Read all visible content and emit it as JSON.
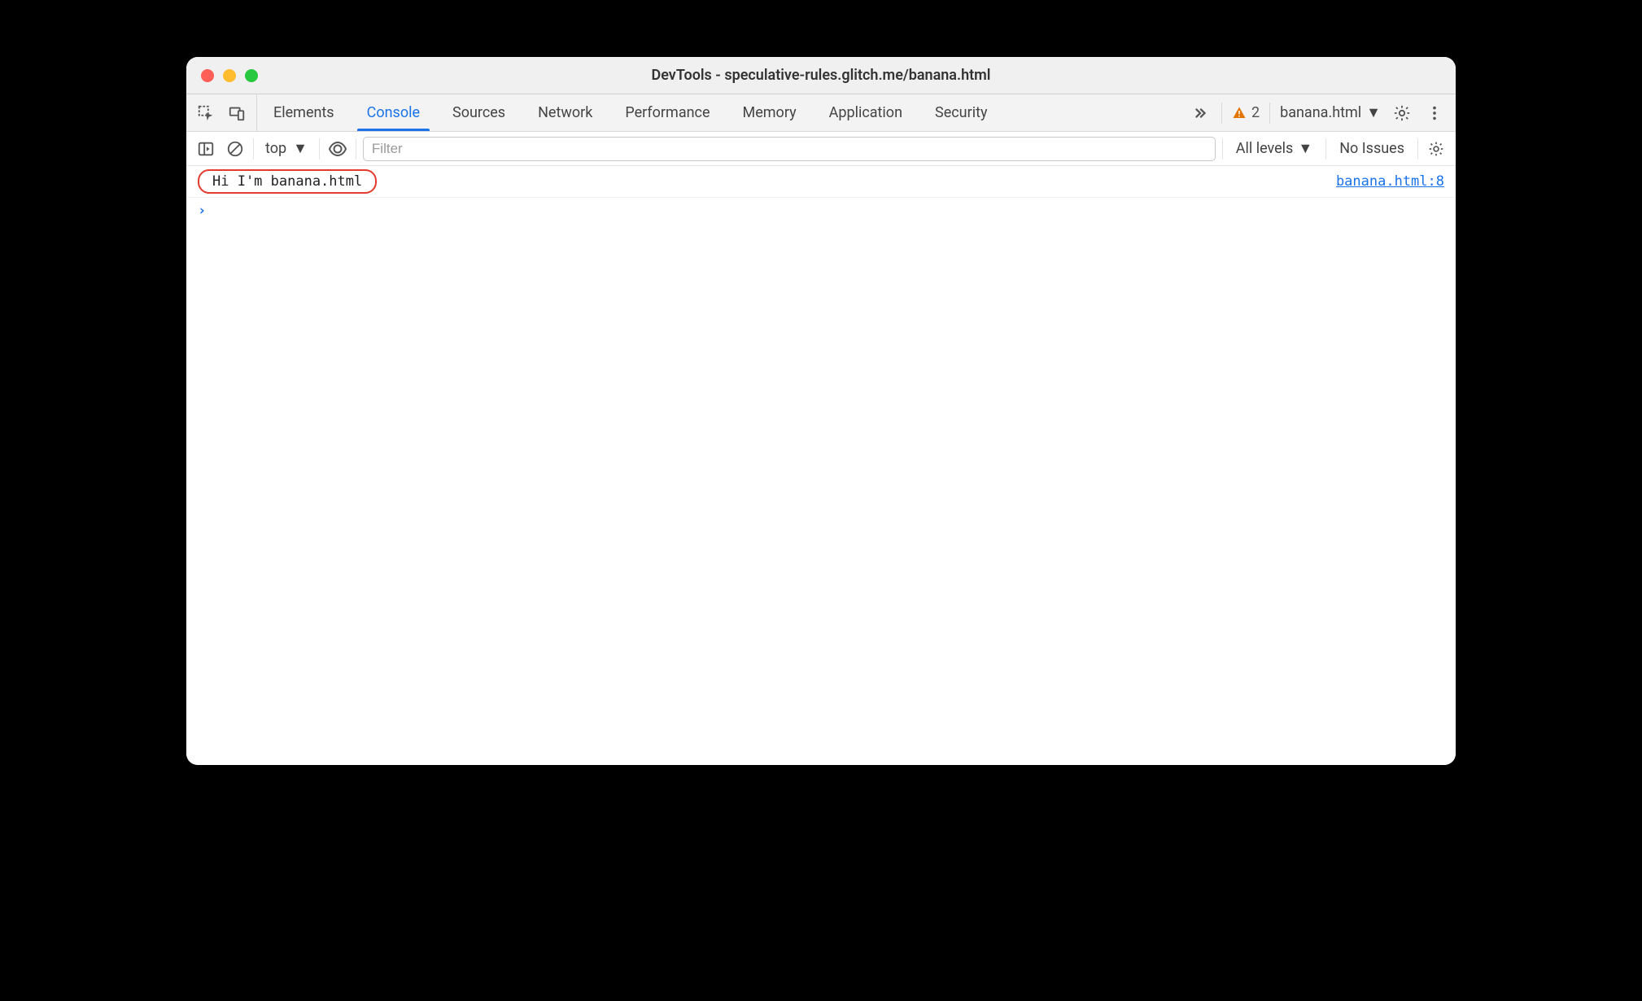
{
  "window": {
    "title": "DevTools - speculative-rules.glitch.me/banana.html"
  },
  "tabs": {
    "items": [
      "Elements",
      "Console",
      "Sources",
      "Network",
      "Performance",
      "Memory",
      "Application",
      "Security"
    ],
    "active_index": 1,
    "warning_count": "2",
    "target_label": "banana.html"
  },
  "toolbar": {
    "context_label": "top",
    "filter_placeholder": "Filter",
    "levels_label": "All levels",
    "issues_label": "No Issues"
  },
  "console": {
    "logs": [
      {
        "message": "Hi I'm banana.html",
        "source": "banana.html:8"
      }
    ]
  }
}
